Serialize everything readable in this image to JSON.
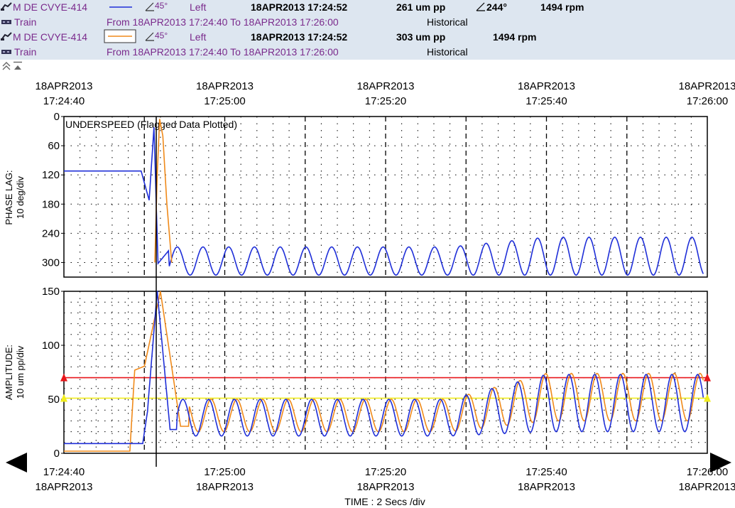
{
  "header": {
    "rows": [
      {
        "point": "M DE CVYE-414",
        "group": "Train",
        "probe_angle": "45°",
        "side": "Left",
        "timestamp": "18APR2013 17:24:52",
        "amplitude": "261 um  pp",
        "phase": "244°",
        "speed": "1494 rpm",
        "range": "From 18APR2013 17:24:40 To 18APR2013 17:26:00",
        "mode": "Historical",
        "line_color": "#1f2fd8"
      },
      {
        "point": "M DE CVYE-414",
        "group": "Train",
        "probe_angle": "45°",
        "side": "Left",
        "timestamp": "18APR2013 17:24:52",
        "amplitude": "303 um  pp",
        "phase": "",
        "speed": "1494 rpm",
        "range": "From 18APR2013 17:24:40 To 18APR2013 17:26:00",
        "mode": "Historical",
        "line_color": "#f08a1a"
      }
    ]
  },
  "chart_data": {
    "type": "line",
    "annotation": "UNDERSPEED (Flagged Data Plotted)",
    "xlabel": "TIME : 2 Secs /div",
    "top_ticks": [
      {
        "date": "18APR2013",
        "time": "17:24:40"
      },
      {
        "date": "18APR2013",
        "time": "17:25:00"
      },
      {
        "date": "18APR2013",
        "time": "17:25:20"
      },
      {
        "date": "18APR2013",
        "time": "17:25:40"
      },
      {
        "date": "18APR2013",
        "time": "17:26:00"
      }
    ],
    "bottom_ticks": [
      {
        "date": "18APR2013",
        "time": "17:24:40"
      },
      {
        "date": "18APR2013",
        "time": "17:25:00"
      },
      {
        "date": "18APR2013",
        "time": "17:25:20"
      },
      {
        "date": "18APR2013",
        "time": "17:25:40"
      },
      {
        "date": "18APR2013",
        "time": "17:26:00"
      }
    ],
    "x_range_seconds": [
      0,
      80
    ],
    "cursor_time": "17:24:52",
    "phase_panel": {
      "ylabel_line1": "PHASE LAG:",
      "ylabel_line2": "10 deg/div",
      "ylim": [
        0,
        330
      ],
      "reversed": true,
      "ticks": [
        0,
        60,
        120,
        180,
        240,
        300
      ],
      "series": [
        {
          "name": "M DE CVYE-414 45° Left (blue)",
          "color": "#1f2fd8",
          "summary": "flat ~112 deg until ~10 s, then drop to ~10 deg at cursor, then oscillates between ~265 and ~328 deg, period ~3.2 s"
        },
        {
          "name": "M DE CVYE-414 45° Left (orange)",
          "color": "#f08a1a",
          "summary": "short spike near cursor from ~300 deg up to ~5 deg"
        }
      ]
    },
    "amplitude_panel": {
      "ylabel_line1": "AMPLITUDE:",
      "ylabel_line2": "10 um  pp/div",
      "ylim": [
        0,
        150
      ],
      "ticks": [
        0,
        50,
        100,
        150
      ],
      "alarm_levels": [
        {
          "name": "danger",
          "value": 70,
          "color": "#e8161b"
        },
        {
          "name": "alert",
          "value": 51,
          "color": "#f2ee1e"
        }
      ],
      "series": [
        {
          "name": "blue",
          "color": "#1f2fd8",
          "summary": "~9 um until ~10 s, sharp rise to ~150 um near cursor, then oscillates ~15–50 um, growing to ~20–73 um"
        },
        {
          "name": "orange",
          "color": "#f08a1a",
          "summary": "~2 um until ~8 s, step to ~78, peak ~150 um near cursor, then oscillates ~20–50 growing to ~30–75 um"
        }
      ]
    }
  }
}
